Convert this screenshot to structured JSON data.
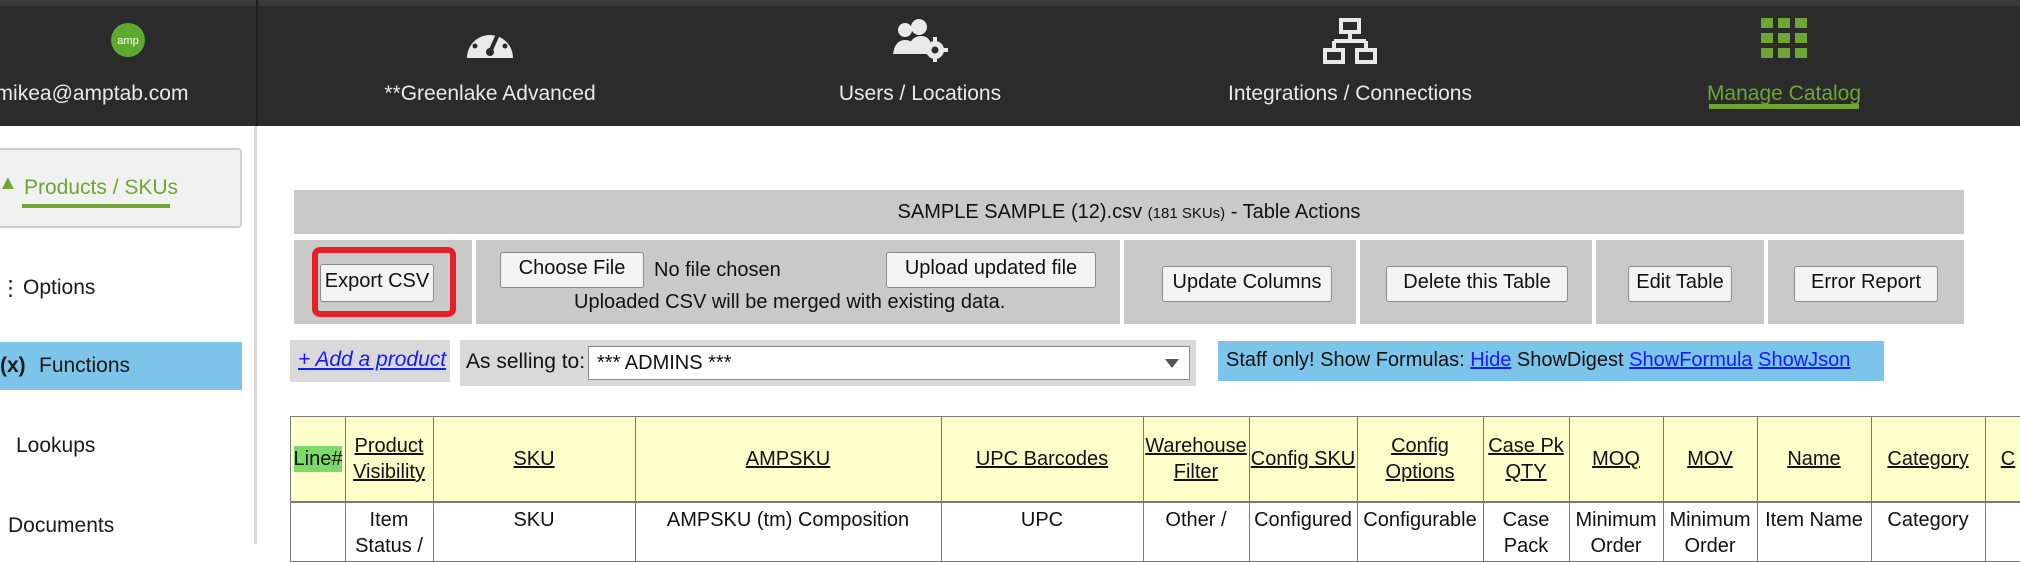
{
  "nav": {
    "items": [
      {
        "label": "mikea@amptab.com",
        "icon": "amp-logo-icon"
      },
      {
        "label": "**Greenlake Advanced",
        "icon": "dashboard-gauge-icon"
      },
      {
        "label": "Users / Locations",
        "icon": "users-gear-icon"
      },
      {
        "label": "Integrations / Connections",
        "icon": "network-icon"
      },
      {
        "label": "Manage Catalog",
        "icon": "grid-icon"
      }
    ],
    "logo_text": "amp",
    "active_color": "#6fa534"
  },
  "sidebar": {
    "items": [
      {
        "label": "Products / SKUs"
      },
      {
        "label": "Options"
      },
      {
        "label": "Functions",
        "icon_text": "(x)"
      },
      {
        "label": "Lookups"
      },
      {
        "label": "Documents"
      }
    ]
  },
  "table_actions": {
    "title": "SAMPLE SAMPLE (12).csv",
    "sku_count": "(181 SKUs)",
    "title_suffix": " - Table Actions",
    "export_csv": "Export CSV",
    "choose_file": "Choose File",
    "no_file": "No file chosen",
    "upload_updated": "Upload updated file",
    "merge_note": "Uploaded CSV will be merged with existing data.",
    "update_columns": "Update Columns",
    "delete_table": "Delete this Table",
    "edit_table": "Edit Table",
    "error_report": "Error Report"
  },
  "controls": {
    "add_product": "+ Add a product",
    "selling_label": "As selling to:",
    "selling_value": "*** ADMINS ***",
    "staff_text": "Staff only! Show Formulas:",
    "hide": "Hide",
    "show_digest": "ShowDigest",
    "show_formula": "ShowFormula",
    "show_json": "ShowJson"
  },
  "grid": {
    "headers": [
      "Line#",
      "Product Visibility",
      "SKU",
      "AMPSKU",
      "UPC Barcodes",
      "Warehouse Filter",
      "Config SKU",
      "Config Options",
      "Case Pk QTY",
      "MOQ",
      "MOV",
      "Name",
      "Category",
      "C"
    ],
    "row1": [
      "",
      "Item Status /",
      "SKU",
      "AMPSKU (tm) Composition",
      "UPC",
      "Other /",
      "Configured",
      "Configurable",
      "Case Pack",
      "Minimum Order",
      "Minimum Order",
      "Item Name",
      "Category",
      ""
    ]
  },
  "colors": {
    "highlight": "#e5202a",
    "selected": "#7cc4ea",
    "link": "#1a1aff",
    "header_bg": "#ffffcc"
  }
}
